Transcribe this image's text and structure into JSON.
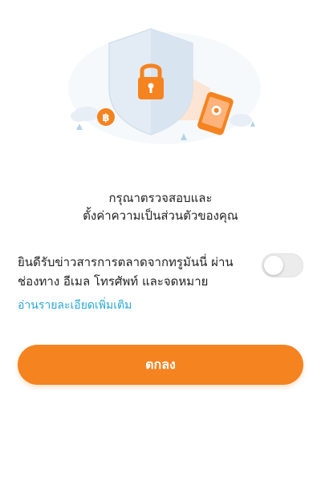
{
  "illustration": {
    "icons": [
      "shield-icon",
      "padlock-icon",
      "phone-icon",
      "coin-icon",
      "cloud-icon",
      "leaf-icon"
    ],
    "coin_symbol": "฿",
    "colors": {
      "shield": "#e3ecf4",
      "lock": "#f58320",
      "phone": "#f58320",
      "coin": "#f58320",
      "beam": "#fde2cf",
      "cloud": "#e8eef5",
      "leaf": "#b7d3e6"
    }
  },
  "heading": {
    "line1": "กรุณาตรวจสอบและ",
    "line2": "ตั้งค่าความเป็นส่วนตัวของคุณ"
  },
  "consent": {
    "line1": "ยินดีรับข่าวสารการตลาดจากทรูมันนี่ ผ่าน",
    "line2": "ช่องทาง อีเมล โทรศัพท์ และจดหมาย",
    "toggle_on": false
  },
  "more_link": "อ่านรายละเอียดเพิ่มเติม",
  "ok_button": "ตกลง",
  "colors": {
    "accent": "#f58320",
    "link": "#2aa8d8",
    "text": "#222222",
    "toggle_off": "#ececec"
  }
}
